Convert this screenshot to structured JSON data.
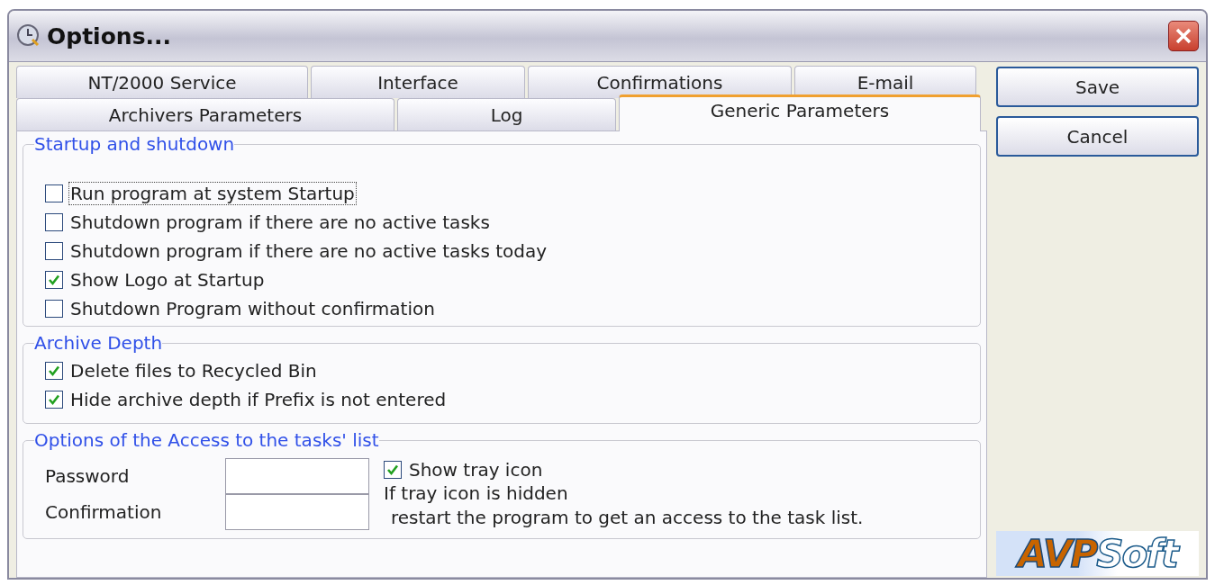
{
  "window": {
    "title": "Options..."
  },
  "tab_rows": [
    [
      {
        "label": "NT/2000 Service",
        "selected": false
      },
      {
        "label": "Interface",
        "selected": false
      },
      {
        "label": "Confirmations",
        "selected": false
      },
      {
        "label": "E-mail",
        "selected": false
      }
    ],
    [
      {
        "label": "Archivers Parameters",
        "selected": false
      },
      {
        "label": "Log",
        "selected": false
      },
      {
        "label": "Generic Parameters",
        "selected": true
      }
    ]
  ],
  "sections": [
    {
      "title": "Startup and shutdown",
      "checkboxes": [
        {
          "label": "Run program at system Startup",
          "checked": false,
          "focused": true
        },
        {
          "label": "Shutdown program if there are no active tasks",
          "checked": false,
          "focused": false
        },
        {
          "label": "Shutdown program if there are no active tasks today",
          "checked": false,
          "focused": false
        },
        {
          "label": "Show Logo at Startup",
          "checked": true,
          "focused": false
        },
        {
          "label": "Shutdown Program without confirmation",
          "checked": false,
          "focused": false
        }
      ]
    },
    {
      "title": "Archive Depth",
      "checkboxes": [
        {
          "label": "Delete files to Recycled Bin",
          "checked": true,
          "focused": false
        },
        {
          "label": "Hide archive depth if Prefix is not entered",
          "checked": true,
          "focused": false
        }
      ]
    }
  ],
  "access": {
    "title": "Options of the Access to the tasks' list",
    "fields": [
      {
        "label": "Password"
      },
      {
        "label": "Confirmation"
      }
    ],
    "checkbox": {
      "label": "Show tray icon",
      "checked": true
    },
    "note": [
      "If tray icon is hidden",
      "restart the program to get an access to the task list."
    ]
  },
  "buttons": [
    "Save",
    "Cancel"
  ],
  "logo": {
    "part_1": "AVP",
    "part_2": "Soft"
  }
}
